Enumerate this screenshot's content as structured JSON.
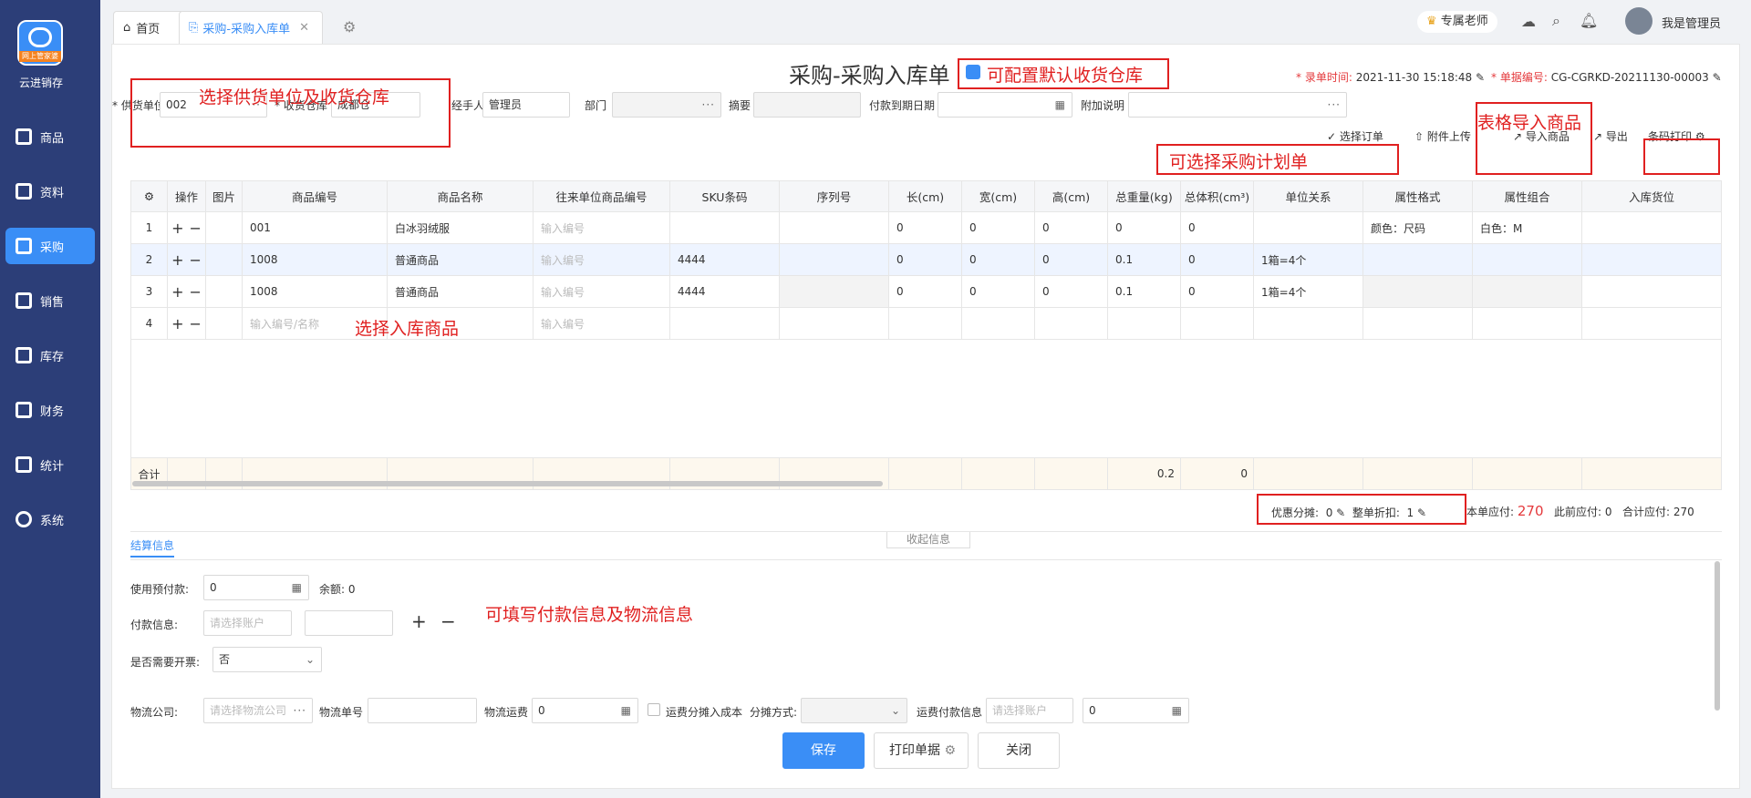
{
  "app": {
    "logo_tag": "网上管家婆",
    "name": "云进销存"
  },
  "nav": [
    {
      "label": "商品",
      "icon": "bag-icon"
    },
    {
      "label": "资料",
      "icon": "document-icon"
    },
    {
      "label": "采购",
      "icon": "book-icon"
    },
    {
      "label": "销售",
      "icon": "chart-icon"
    },
    {
      "label": "库存",
      "icon": "house-icon"
    },
    {
      "label": "财务",
      "icon": "money-icon"
    },
    {
      "label": "统计",
      "icon": "trend-icon"
    },
    {
      "label": "系统",
      "icon": "gear-icon"
    }
  ],
  "tabs": {
    "home": "首页",
    "active": "采购-采购入库单"
  },
  "top": {
    "teacher": "专属老师",
    "user": "我是管理员"
  },
  "header": {
    "title": "采购-采购入库单",
    "record_time_label": "* 录单时间:",
    "record_time": "2021-11-30 15:18:48",
    "doc_no_label": "* 单据编号:",
    "doc_no": "CG-CGRKD-20211130-00003"
  },
  "form": {
    "supplier_label": "* 供货单位",
    "supplier": "002",
    "warehouse_label": "* 收货仓库",
    "warehouse": "成都仓",
    "handler_label": "经手人",
    "handler": "管理员",
    "dept_label": "部门",
    "summary_label": "摘要",
    "due_label": "付款到期日期",
    "remark_label": "附加说明"
  },
  "toolbar": {
    "select_order": "选择订单",
    "attach": "附件上传",
    "import": "导入商品",
    "export": "导出",
    "barcode": "条码打印"
  },
  "annotations": {
    "supplier": "选择供货单位及收货仓库",
    "warehouse_cfg": "可配置默认收货仓库",
    "plan": "可选择采购计划单",
    "import": "表格导入商品",
    "choose_goods": "选择入库商品",
    "payment": "可填写付款信息及物流信息"
  },
  "table": {
    "headers": [
      "操作",
      "图片",
      "商品编号",
      "商品名称",
      "往来单位商品编号",
      "SKU条码",
      "序列号",
      "长(cm)",
      "宽(cm)",
      "高(cm)",
      "总重量(kg)",
      "总体积(cm³)",
      "单位关系",
      "属性格式",
      "属性组合",
      "入库货位"
    ],
    "rows": [
      {
        "no": "1",
        "code": "001",
        "name": "白冰羽绒服",
        "pcode": "输入编号",
        "sku": "",
        "l": "0",
        "w": "0",
        "h": "0",
        "weight": "0",
        "vol": "0",
        "unit": "",
        "attr": "颜色：尺码",
        "combo": "白色：M"
      },
      {
        "no": "2",
        "code": "1008",
        "name": "普通商品",
        "pcode": "输入编号",
        "sku": "4444",
        "l": "0",
        "w": "0",
        "h": "0",
        "weight": "0.1",
        "vol": "0",
        "unit": "1箱=4个",
        "attr": "",
        "combo": ""
      },
      {
        "no": "3",
        "code": "1008",
        "name": "普通商品",
        "pcode": "输入编号",
        "sku": "4444",
        "l": "0",
        "w": "0",
        "h": "0",
        "weight": "0.1",
        "vol": "0",
        "unit": "1箱=4个",
        "attr": "",
        "combo": ""
      },
      {
        "no": "4",
        "code": "输入编号/名称",
        "name": "",
        "pcode": "输入编号",
        "sku": "",
        "l": "",
        "w": "",
        "h": "",
        "weight": "",
        "vol": "",
        "unit": "",
        "attr": "",
        "combo": ""
      }
    ],
    "total_label": "合计",
    "total_weight": "0.2",
    "total_vol": "0"
  },
  "summary": {
    "discount_label": "优惠分摊:",
    "discount": "0",
    "rebate_label": "整单折扣:",
    "rebate": "1",
    "payable_label": "本单应付:",
    "payable": "270",
    "prev_label": "此前应付:",
    "prev": "0",
    "total_label": "合计应付:",
    "total": "270",
    "collapse": "收起信息"
  },
  "settle": {
    "tab": "结算信息",
    "prepay_label": "使用预付款:",
    "prepay": "0",
    "balance_label": "余额:",
    "balance": "0",
    "payinfo_label": "付款信息:",
    "account_ph": "请选择账户",
    "invoice_label": "是否需要开票:",
    "invoice": "否",
    "logi_label": "物流公司:",
    "logi_ph": "请选择物流公司",
    "logino_label": "物流单号",
    "fee_label": "物流运费",
    "fee": "0",
    "share_label": "运费分摊入成本",
    "share_mode_label": "分摊方式:",
    "feepay_label": "运费付款信息",
    "feeacc_ph": "请选择账户",
    "feeamt": "0"
  },
  "buttons": {
    "save": "保存",
    "print": "打印单据",
    "close": "关闭"
  }
}
